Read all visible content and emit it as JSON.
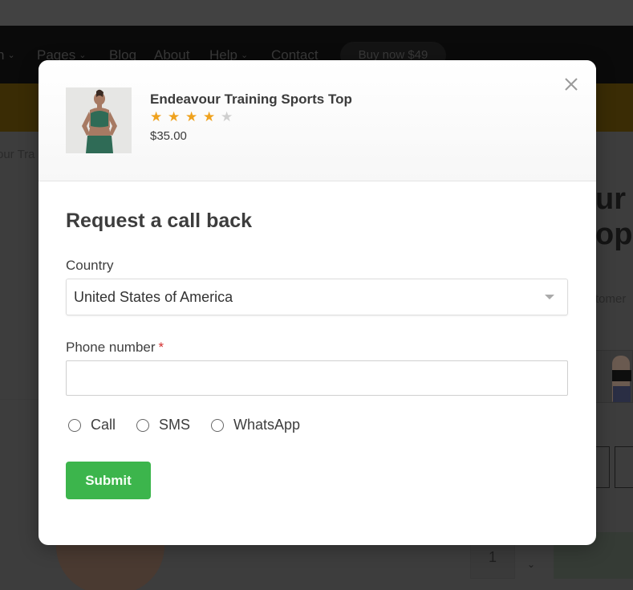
{
  "background": {
    "nav": {
      "items": [
        {
          "label": "n",
          "has_chevron": true
        },
        {
          "label": "Pages",
          "has_chevron": true
        },
        {
          "label": "Blog",
          "has_chevron": false
        },
        {
          "label": "About",
          "has_chevron": false
        },
        {
          "label": "Help",
          "has_chevron": true
        },
        {
          "label": "Contact",
          "has_chevron": false
        }
      ],
      "chevron": "⌄",
      "buy_button": "Buy now $49"
    },
    "breadcrumb": "our Tra",
    "product_title_fragment": [
      "ur",
      "op"
    ],
    "customer_fragment": "tomer",
    "quantity": "1",
    "qty_up": "⌃",
    "qty_down": "⌄"
  },
  "modal": {
    "product": {
      "name": "Endeavour Training Sports Top",
      "rating": 4,
      "rating_max": 5,
      "star_glyph": "★",
      "price": "$35.00",
      "accent_star_color": "#efa21e"
    },
    "form": {
      "title": "Request a call back",
      "country_label": "Country",
      "country_value": "United States of America",
      "phone_label": "Phone number",
      "required_marker": "*",
      "phone_value": "",
      "contact_methods": [
        {
          "label": "Call",
          "selected": false
        },
        {
          "label": "SMS",
          "selected": false
        },
        {
          "label": "WhatsApp",
          "selected": false
        }
      ],
      "submit_label": "Submit",
      "submit_color": "#3cb54c"
    }
  }
}
